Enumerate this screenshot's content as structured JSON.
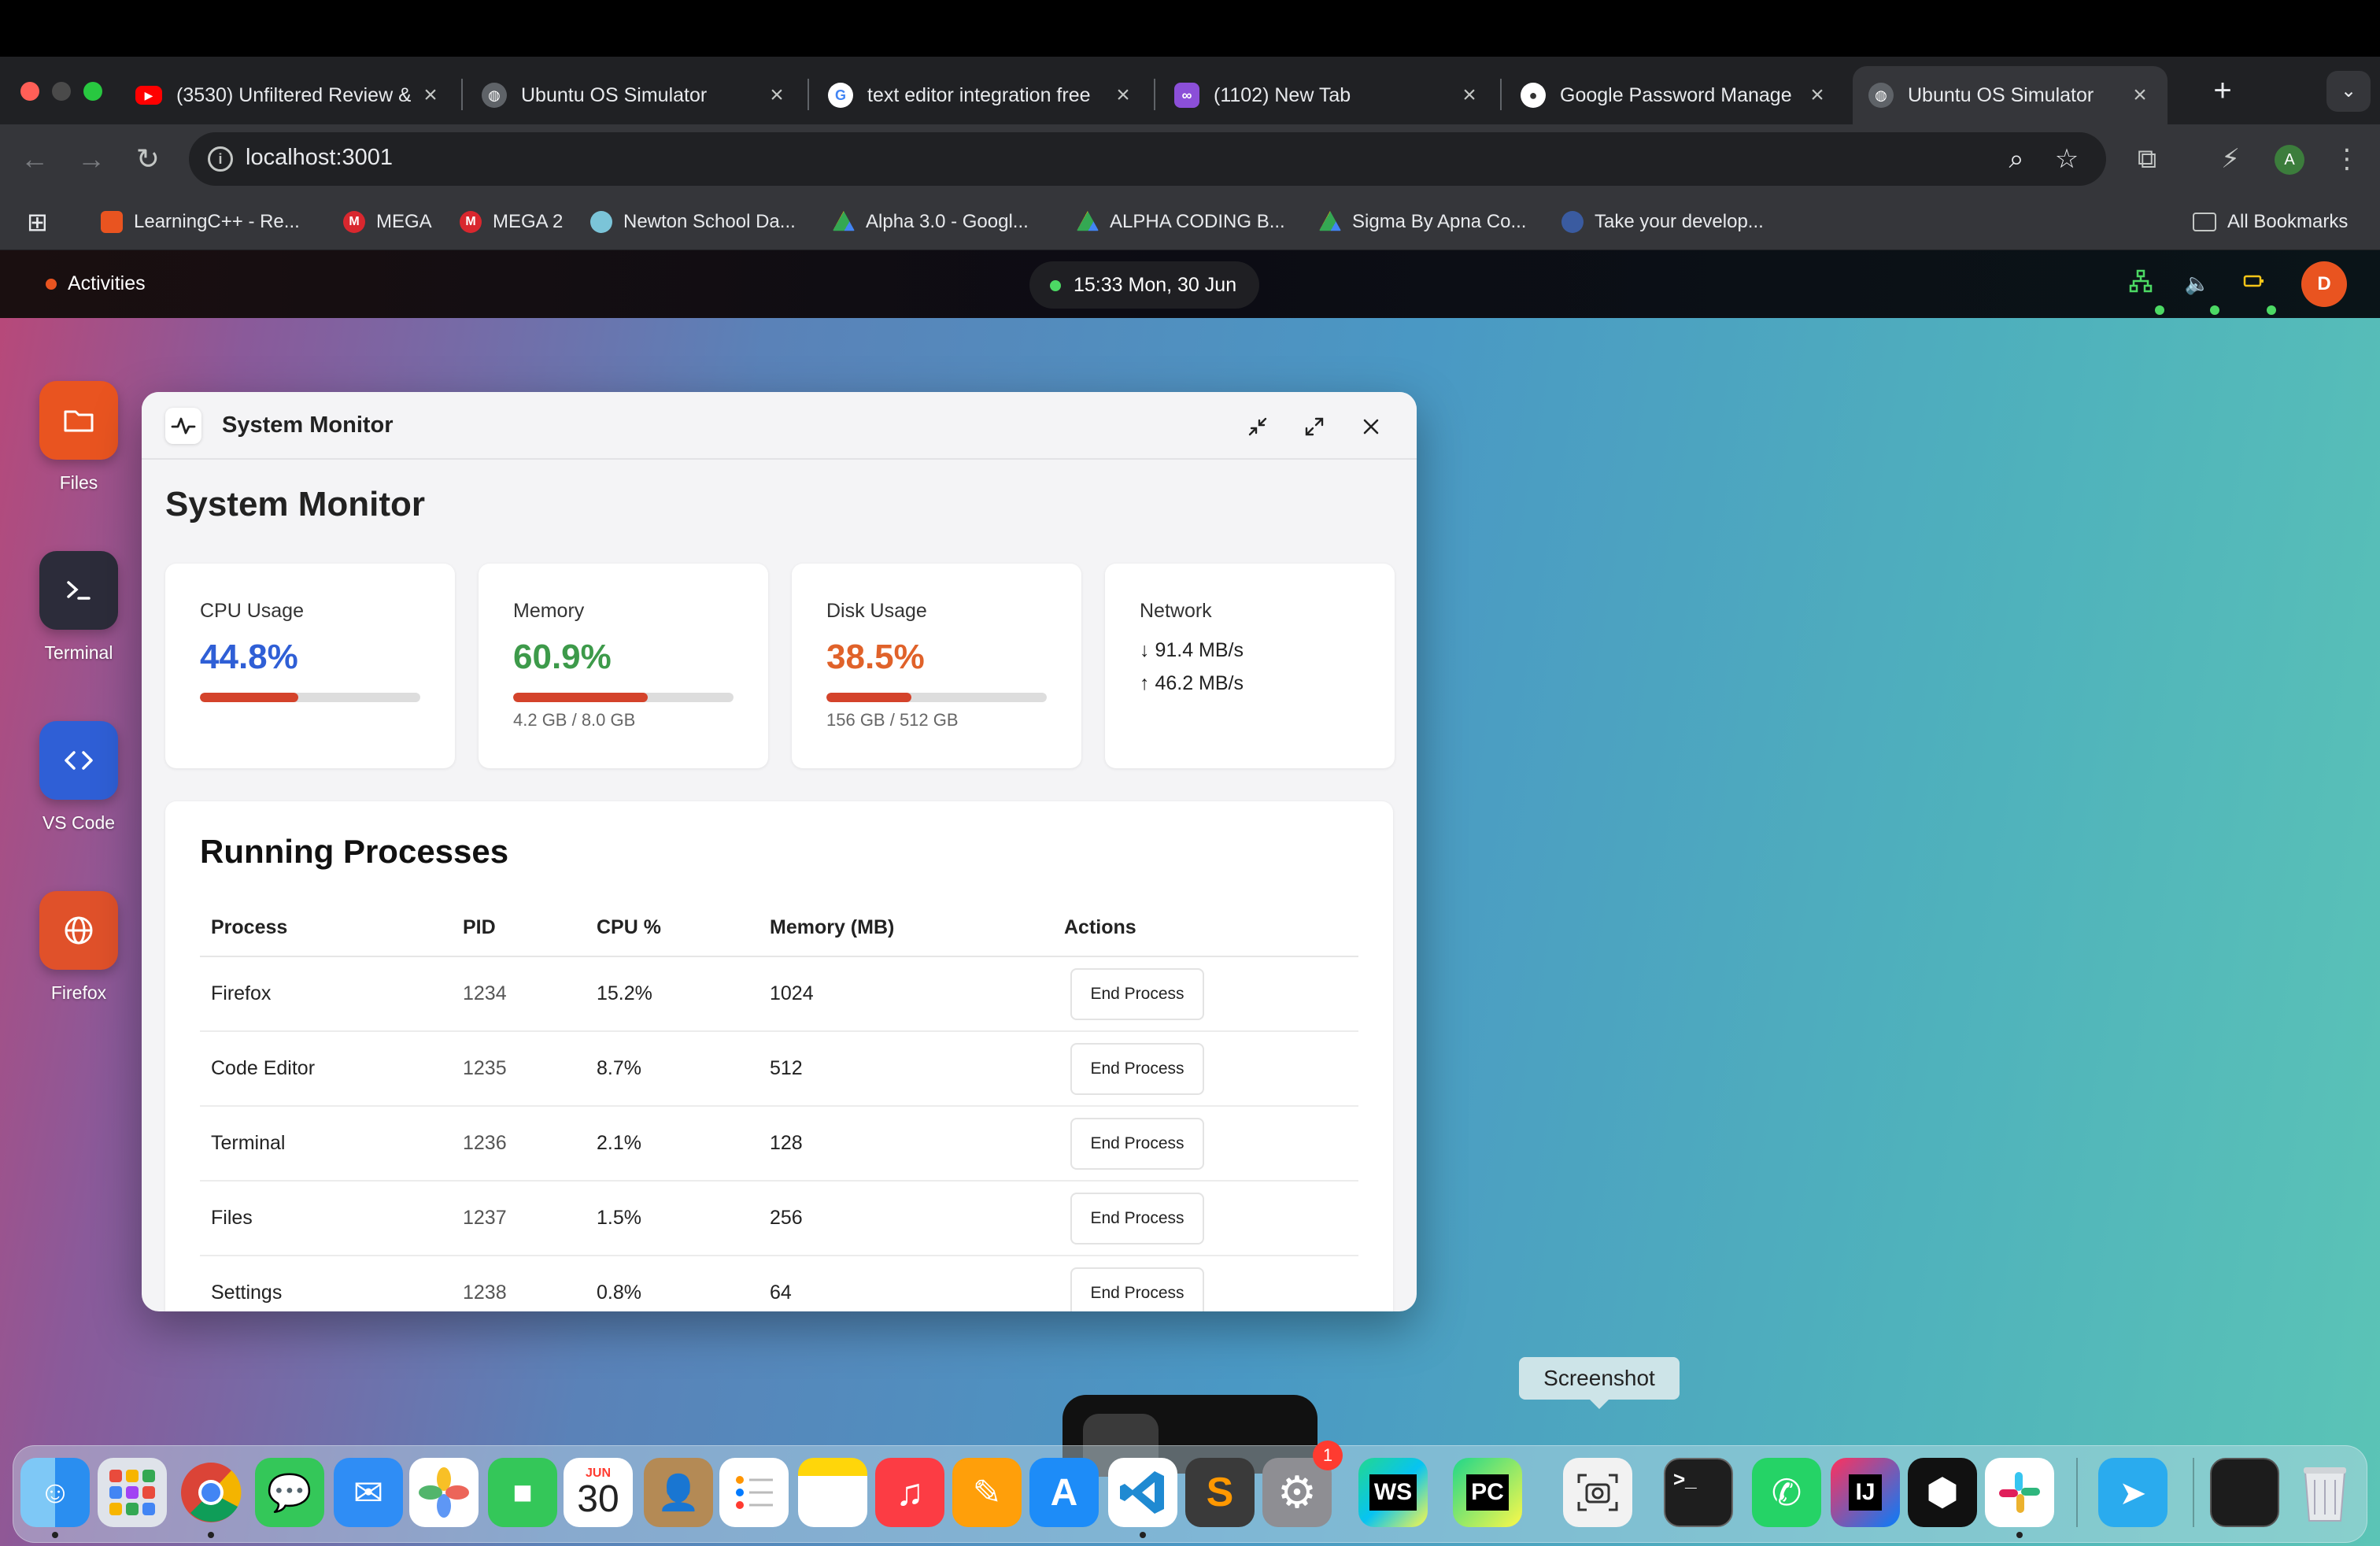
{
  "browser": {
    "tabs": [
      {
        "title": "(3530) Unfiltered Review &",
        "favicon": "youtube-icon"
      },
      {
        "title": "Ubuntu OS Simulator",
        "favicon": "globe-icon"
      },
      {
        "title": "text editor integration free",
        "favicon": "google-icon"
      },
      {
        "title": "(1102) New Tab",
        "favicon": "app-icon"
      },
      {
        "title": "Google Password Manage",
        "favicon": "password-icon"
      },
      {
        "title": "Ubuntu OS Simulator",
        "favicon": "globe-icon",
        "active": true
      }
    ],
    "url": "localhost:3001",
    "profile_initial": "A",
    "bookmarks": [
      {
        "label": "LearningC++ - Re..."
      },
      {
        "label": "MEGA"
      },
      {
        "label": "MEGA 2"
      },
      {
        "label": "Newton School Da..."
      },
      {
        "label": "Alpha 3.0 - Googl..."
      },
      {
        "label": "ALPHA CODING B..."
      },
      {
        "label": "Sigma By Apna Co..."
      },
      {
        "label": "Take your develop..."
      }
    ],
    "all_bookmarks": "All Bookmarks"
  },
  "ubuntu": {
    "activities": "Activities",
    "clock": "15:33 Mon, 30 Jun",
    "user_initial": "D",
    "sidebar": [
      {
        "label": "Files",
        "icon": "folder-icon",
        "color": "#e95420"
      },
      {
        "label": "Terminal",
        "icon": "terminal-icon",
        "color": "#2c2c3a"
      },
      {
        "label": "VS Code",
        "icon": "code-icon",
        "color": "#2f5fd6"
      },
      {
        "label": "Firefox",
        "icon": "globe-icon",
        "color": "#e0512a"
      }
    ]
  },
  "window": {
    "title": "System Monitor",
    "heading": "System Monitor",
    "cards": {
      "cpu": {
        "label": "CPU Usage",
        "value": "44.8%",
        "percent": 44.8,
        "color": "#2f5fd6"
      },
      "memory": {
        "label": "Memory",
        "value": "60.9%",
        "percent": 60.9,
        "detail": "4.2 GB / 8.0 GB",
        "color": "#3d9a4a"
      },
      "disk": {
        "label": "Disk Usage",
        "value": "38.5%",
        "percent": 38.5,
        "detail": "156 GB / 512 GB",
        "color": "#e0622a"
      },
      "network": {
        "label": "Network",
        "down": "↓ 91.4 MB/s",
        "up": "↑ 46.2 MB/s"
      }
    },
    "processes": {
      "title": "Running Processes",
      "headers": {
        "process": "Process",
        "pid": "PID",
        "cpu": "CPU %",
        "memory": "Memory (MB)",
        "actions": "Actions"
      },
      "end_label": "End Process",
      "rows": [
        {
          "name": "Firefox",
          "pid": "1234",
          "cpu": "15.2%",
          "memory": "1024"
        },
        {
          "name": "Code Editor",
          "pid": "1235",
          "cpu": "8.7%",
          "memory": "512"
        },
        {
          "name": "Terminal",
          "pid": "1236",
          "cpu": "2.1%",
          "memory": "128"
        },
        {
          "name": "Files",
          "pid": "1237",
          "cpu": "1.5%",
          "memory": "256"
        },
        {
          "name": "Settings",
          "pid": "1238",
          "cpu": "0.8%",
          "memory": "64"
        }
      ]
    }
  },
  "tooltip": "Screenshot",
  "dock": {
    "calendar_month": "JUN",
    "calendar_day": "30",
    "settings_badge": "1",
    "webstorm_label": "WS",
    "pycharm_label": "PC",
    "intellij_label": "IJ"
  }
}
